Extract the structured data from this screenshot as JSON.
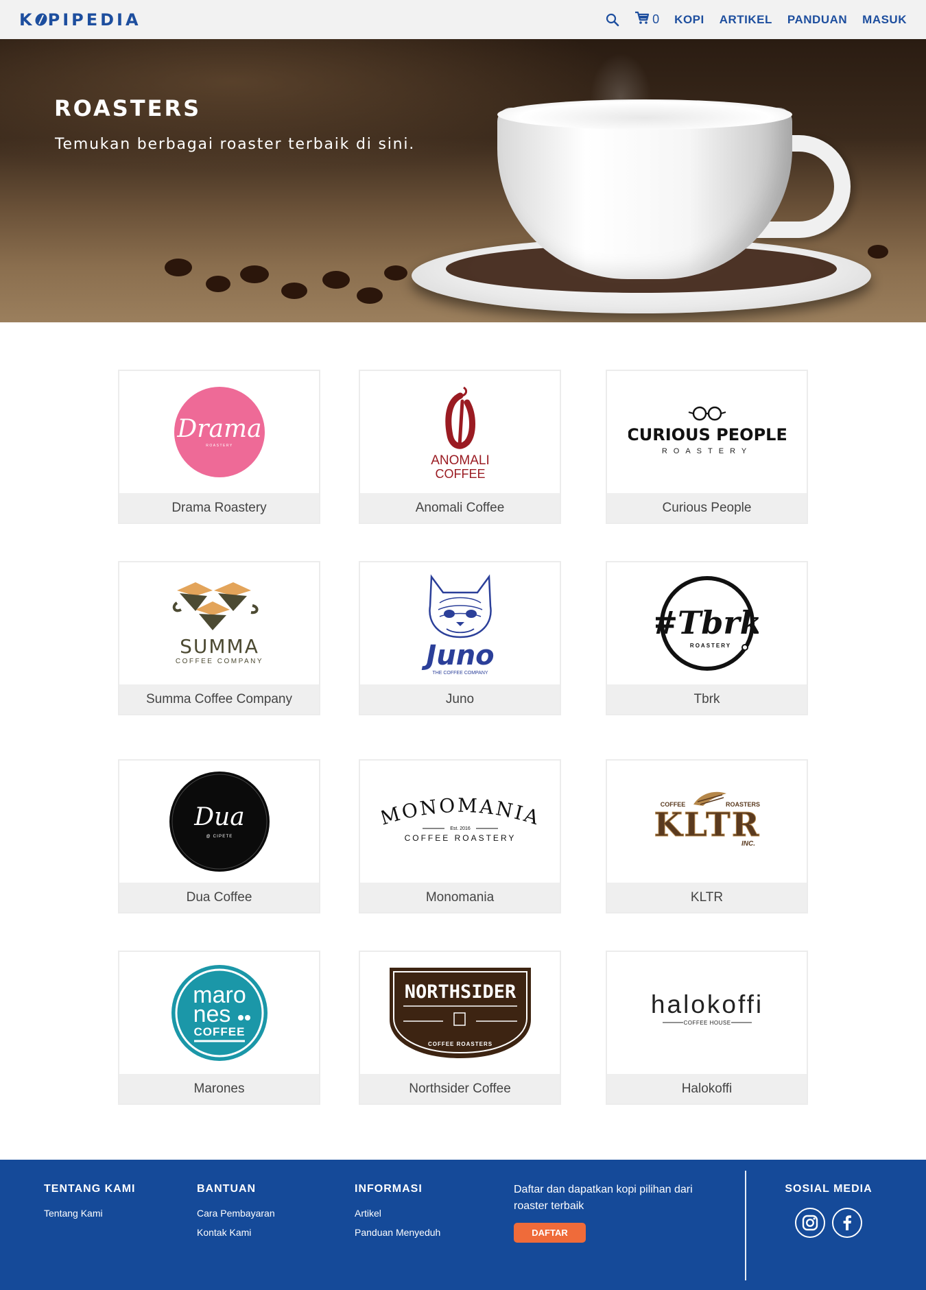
{
  "header": {
    "logo": "KOPIPEDIA",
    "cart_count": "0",
    "nav": [
      "KOPI",
      "ARTIKEL",
      "PANDUAN",
      "MASUK"
    ],
    "accent_color": "#1d4e9e"
  },
  "hero": {
    "title": "ROASTERS",
    "subtitle": "Temukan berbagai roaster terbaik di sini."
  },
  "roasters": [
    {
      "name": "Drama Roastery",
      "logo": {
        "main": "Drama",
        "sub": "ROASTERY"
      }
    },
    {
      "name": "Anomali Coffee",
      "logo": {
        "line1": "ANOMALI",
        "line2": "COFFEE"
      }
    },
    {
      "name": "Curious People",
      "logo": {
        "main": "CURIOUS PEOPLE",
        "sub": "ROASTERY"
      }
    },
    {
      "name": "Summa Coffee Company",
      "logo": {
        "main": "SUMMA",
        "sub": "COFFEE COMPANY"
      }
    },
    {
      "name": "Juno",
      "logo": {
        "main": "Juno",
        "sub": "THE COFFEE COMPANY"
      }
    },
    {
      "name": "Tbrk",
      "logo": {
        "main": "#Tbrk",
        "sub": "ROASTERY"
      }
    },
    {
      "name": "Dua Coffee",
      "logo": {
        "main": "Dua",
        "sub": "@ CIPETE"
      }
    },
    {
      "name": "Monomania",
      "logo": {
        "main": "MONOMANIA",
        "est": "Est. 2016",
        "sub": "COFFEE ROASTERY"
      }
    },
    {
      "name": "KLTR",
      "logo": {
        "left": "COFFEE",
        "right": "ROASTERS",
        "main": "KLTR",
        "sub": "INC."
      }
    },
    {
      "name": "Marones",
      "logo": {
        "line1": "maro",
        "line2": "nes",
        "line3": "COFFEE"
      }
    },
    {
      "name": "Northsider Coffee",
      "logo": {
        "main": "NORTHSIDER",
        "sub": "COFFEE ROASTERS"
      }
    },
    {
      "name": "Halokoffi",
      "logo": {
        "main": "halokoffi",
        "sub": "COFFEE HOUSE"
      }
    }
  ],
  "footer": {
    "about": {
      "heading": "TENTANG KAMI",
      "links": [
        "Tentang Kami"
      ]
    },
    "help": {
      "heading": "BANTUAN",
      "links": [
        "Cara Pembayaran",
        "Kontak Kami"
      ]
    },
    "info": {
      "heading": "INFORMASI",
      "links": [
        "Artikel",
        "Panduan Menyeduh"
      ]
    },
    "promo": {
      "text": "Daftar dan dapatkan kopi pilihan dari roaster terbaik",
      "button": "DAFTAR"
    },
    "social": {
      "heading": "SOSIAL MEDIA",
      "icons": [
        "instagram-icon",
        "facebook-icon"
      ]
    },
    "bg_color": "#154a99",
    "button_color": "#ef6b3a"
  }
}
